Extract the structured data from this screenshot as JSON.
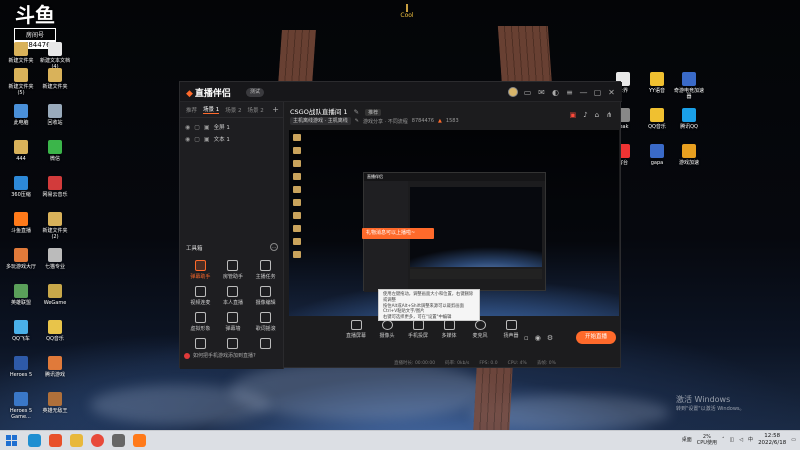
{
  "desktop": {
    "stream_logo": {
      "glyph": "斗鱼",
      "room_label": "房间号",
      "room_number": "8784476"
    },
    "badge": "Cool",
    "icons_left": [
      {
        "label": "新建文件夹",
        "color": "#d9b25a"
      },
      {
        "label": "新建文本文档\n(4)",
        "color": "#e8e8e8"
      },
      {
        "label": "新建文件夹\n(5)",
        "color": "#d9b25a"
      },
      {
        "label": "新建文件夹",
        "color": "#d9b25a"
      },
      {
        "label": "此电脑",
        "color": "#4a90d9"
      },
      {
        "label": "回收站",
        "color": "#9ab"
      },
      {
        "label": "444",
        "color": "#d9b25a"
      },
      {
        "label": "微信",
        "color": "#3bb54a"
      },
      {
        "label": "360压缩",
        "color": "#2d89d8"
      },
      {
        "label": "网易云音乐",
        "color": "#d23b3b"
      },
      {
        "label": "斗鱼直播",
        "color": "#ff7a1a"
      },
      {
        "label": "新建文件夹\n(2)",
        "color": "#d9b25a"
      },
      {
        "label": "多玩游戏大厅",
        "color": "#e07a3a"
      },
      {
        "label": "七猫专业",
        "color": "#bbb"
      },
      {
        "label": "英雄联盟",
        "color": "#5aa05a"
      },
      {
        "label": "WeGame",
        "color": "#c8a84a"
      },
      {
        "label": "QQ飞车",
        "color": "#4ab0e8"
      },
      {
        "label": "QQ音乐",
        "color": "#e8c44a"
      },
      {
        "label": "Heroes 5",
        "color": "#2e5aa8"
      },
      {
        "label": "腾讯游戏",
        "color": "#e07a3a"
      },
      {
        "label": "Heroes 5 Game...",
        "color": "#3a78c8"
      },
      {
        "label": "英雄无敌王",
        "color": "#b0703a"
      }
    ],
    "icons_right": [
      {
        "label": "世界",
        "color": "#e8e8e8"
      },
      {
        "label": "YY语音",
        "color": "#f0c030"
      },
      {
        "label": "奇游电竞加速器",
        "color": "#3a6ac8"
      },
      {
        "label": "reak",
        "color": "#888"
      },
      {
        "label": "QQ音乐",
        "color": "#f0c030"
      },
      {
        "label": "腾讯QQ",
        "color": "#1aa0e8"
      },
      {
        "label": "客台",
        "color": "#e33"
      },
      {
        "label": "gapa",
        "color": "#3a6ac8"
      },
      {
        "label": "游戏加速",
        "color": "#e8a020"
      }
    ],
    "watermark": {
      "line1": "激活 Windows",
      "line2": "转到\"设置\"以激活 Windows。"
    }
  },
  "app": {
    "title": "直播伴侣",
    "version_badge": "测试",
    "scene_tabs": [
      "推荐",
      "场景 1",
      "场景 2",
      "场景 2"
    ],
    "active_tab_index": 1,
    "sources": [
      {
        "name": "全屏 1"
      },
      {
        "name": "文本 1"
      }
    ],
    "toolbox_title": "工具箱",
    "tools": [
      {
        "label": "弹幕助手",
        "hot": true
      },
      {
        "label": "房管助手",
        "hot": false
      },
      {
        "label": "主播任务",
        "hot": false
      },
      {
        "label": "视频连麦",
        "hot": false
      },
      {
        "label": "本人直播",
        "hot": false
      },
      {
        "label": "摄像编辑",
        "hot": false
      },
      {
        "label": "虚拟形象",
        "hot": false
      },
      {
        "label": "弹幕墙",
        "hot": false
      },
      {
        "label": "歌词摇滚",
        "hot": false
      },
      {
        "label": "",
        "hot": false
      },
      {
        "label": "",
        "hot": false
      },
      {
        "label": "",
        "hot": false
      }
    ],
    "bottom_hint": "如何把手机游戏添加到直播?",
    "room": {
      "title": "CSGO战队直播间 1",
      "category_tag": "推荐",
      "chip1": "主机离线游戏 · 主机离线",
      "info_text": "游戏分享 · 不同流程",
      "room_id": "8784476",
      "heat": "1583"
    },
    "preview_orange_tip": "礼物消息可以上播啦~",
    "tooltip_lines": [
      "使用左键拖动，调整画面大小和位置，右键删除或调整",
      "按住Alt或Alt+Shift调整来源可以裁剪画面",
      "Ctrl+V粘贴文字/图片",
      "右键可选择更多，可在\"设置\"中编辑"
    ],
    "controls": [
      {
        "label": "直播屏幕"
      },
      {
        "label": "摄像头"
      },
      {
        "label": "手机投屏"
      },
      {
        "label": "多媒体"
      },
      {
        "label": "麦克风"
      },
      {
        "label": "扬声器"
      }
    ],
    "go_live_label": "开始直播",
    "status": [
      "直播时长: 00:00:00",
      "码率: 0kb/s",
      "FPS: 0.0",
      "CPU: 4%",
      "丢帧: 0%"
    ]
  },
  "taskbar": {
    "apps": [
      {
        "name": "start",
        "color": "#1f6fd1"
      },
      {
        "name": "edge",
        "color": "#1f8fd1"
      },
      {
        "name": "huya",
        "color": "#e8502a"
      },
      {
        "name": "folder",
        "color": "#e8b83a"
      },
      {
        "name": "chrome",
        "color": "#e84a3a"
      },
      {
        "name": "settings",
        "color": "#666"
      },
      {
        "name": "douyu",
        "color": "#ff7a1a"
      }
    ],
    "tray_label": "桌面",
    "cpu_value": "2%",
    "cpu_label": "CPU使用",
    "time": "12:58",
    "date": "2022/6/18"
  }
}
